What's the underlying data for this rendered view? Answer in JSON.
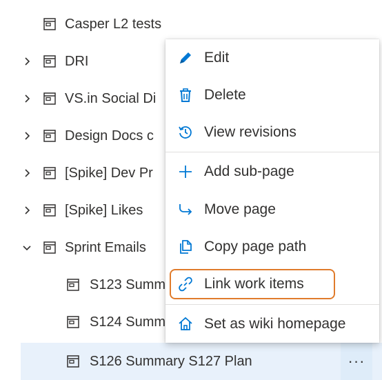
{
  "colors": {
    "accent": "#0078d4",
    "focus_outline": "#e07b2b",
    "selected_row": "#e8f1fb"
  },
  "tree": {
    "items": [
      {
        "label": "Casper L2 tests",
        "chevron": "none"
      },
      {
        "label": "DRI",
        "chevron": "right"
      },
      {
        "label": "VS.in Social Di",
        "chevron": "right"
      },
      {
        "label": "Design Docs c",
        "chevron": "right"
      },
      {
        "label": "[Spike] Dev Pr",
        "chevron": "right"
      },
      {
        "label": "[Spike] Likes",
        "chevron": "right"
      },
      {
        "label": "Sprint Emails",
        "chevron": "down"
      },
      {
        "label": "S123 Summ",
        "chevron": "none"
      },
      {
        "label": "S124 Summ",
        "chevron": "none"
      },
      {
        "label": "S126 Summary S127 Plan",
        "chevron": "none"
      }
    ],
    "more_label": "···"
  },
  "menu": {
    "items": [
      {
        "label": "Edit",
        "icon": "pencil-icon"
      },
      {
        "label": "Delete",
        "icon": "trash-icon"
      },
      {
        "label": "View revisions",
        "icon": "history-icon"
      },
      {
        "label": "Add sub-page",
        "icon": "plus-icon"
      },
      {
        "label": "Move page",
        "icon": "move-arrow-icon"
      },
      {
        "label": "Copy page path",
        "icon": "copy-icon"
      },
      {
        "label": "Link work items",
        "icon": "link-icon"
      },
      {
        "label": "Set as wiki homepage",
        "icon": "home-icon"
      }
    ]
  }
}
